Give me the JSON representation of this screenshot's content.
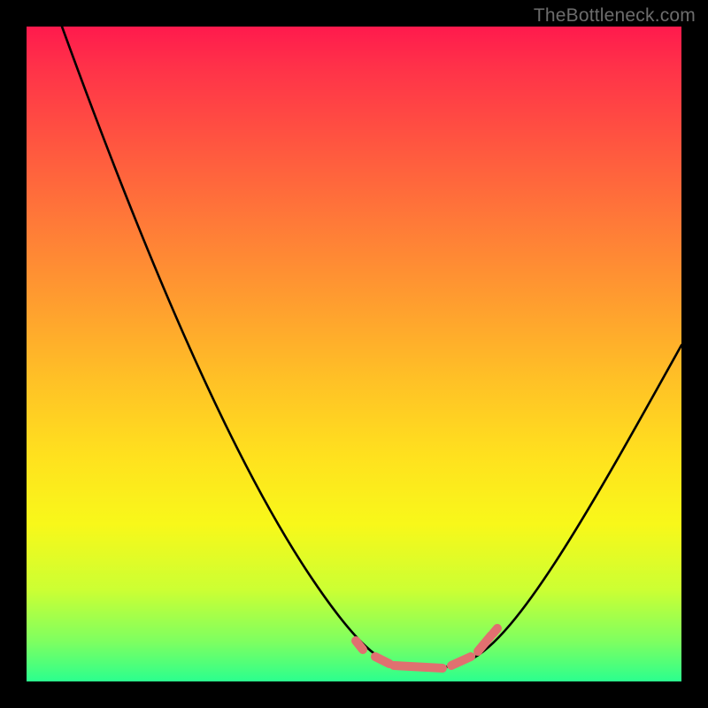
{
  "watermark": "TheBottleneck.com",
  "chart_data": {
    "type": "line",
    "title": "",
    "xlabel": "",
    "ylabel": "",
    "xlim": [
      0,
      100
    ],
    "ylim": [
      0,
      100
    ],
    "grid": false,
    "legend": false,
    "x": [
      0,
      5,
      10,
      15,
      20,
      25,
      30,
      35,
      40,
      45,
      50,
      55,
      60,
      65,
      70,
      75,
      80,
      85,
      90,
      95,
      100
    ],
    "series": [
      {
        "name": "bottleneck-curve",
        "values": [
          100,
          89,
          80,
          72,
          64,
          56.5,
          49,
          41.5,
          34,
          26,
          18,
          10,
          3.5,
          1,
          1,
          4,
          12,
          22,
          32,
          42,
          52
        ],
        "color": "#000000"
      }
    ],
    "markers": {
      "name": "bottom-points",
      "color": "#e07070",
      "points": [
        {
          "x": 53,
          "y": 7
        },
        {
          "x": 55,
          "y": 5
        },
        {
          "x": 57,
          "y": 3.8
        },
        {
          "x": 59,
          "y": 2.8
        },
        {
          "x": 61,
          "y": 2
        },
        {
          "x": 63,
          "y": 1.7
        },
        {
          "x": 65,
          "y": 1.7
        },
        {
          "x": 67,
          "y": 2.2
        },
        {
          "x": 69,
          "y": 3.3
        },
        {
          "x": 72,
          "y": 6
        }
      ]
    },
    "background_gradient_stops": [
      {
        "pos": 0.0,
        "hex": "#ff1a4d"
      },
      {
        "pos": 0.18,
        "hex": "#ff5640"
      },
      {
        "pos": 0.42,
        "hex": "#ff9d2f"
      },
      {
        "pos": 0.66,
        "hex": "#ffe21e"
      },
      {
        "pos": 0.86,
        "hex": "#ccff33"
      },
      {
        "pos": 1.0,
        "hex": "#2bff8e"
      }
    ]
  }
}
